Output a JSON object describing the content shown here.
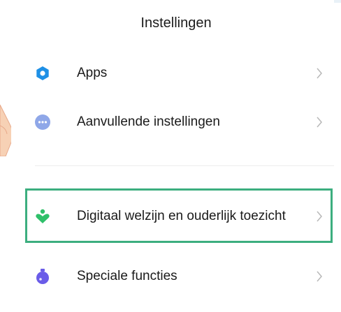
{
  "header": {
    "title": "Instellingen"
  },
  "items": [
    {
      "label": "Apps",
      "icon": "gear-icon",
      "icon_color": "#1e90e6"
    },
    {
      "label": "Aanvullende instellingen",
      "icon": "more-dots-icon",
      "icon_color": "#8fa7e8"
    },
    {
      "label": "Digitaal welzijn en ouderlijk toezicht",
      "icon": "digital-wellbeing-icon",
      "icon_color": "#2fc06a"
    },
    {
      "label": "Speciale functies",
      "icon": "flask-icon",
      "icon_color": "#6a5ce8"
    }
  ],
  "highlight_color": "#3cae7f"
}
